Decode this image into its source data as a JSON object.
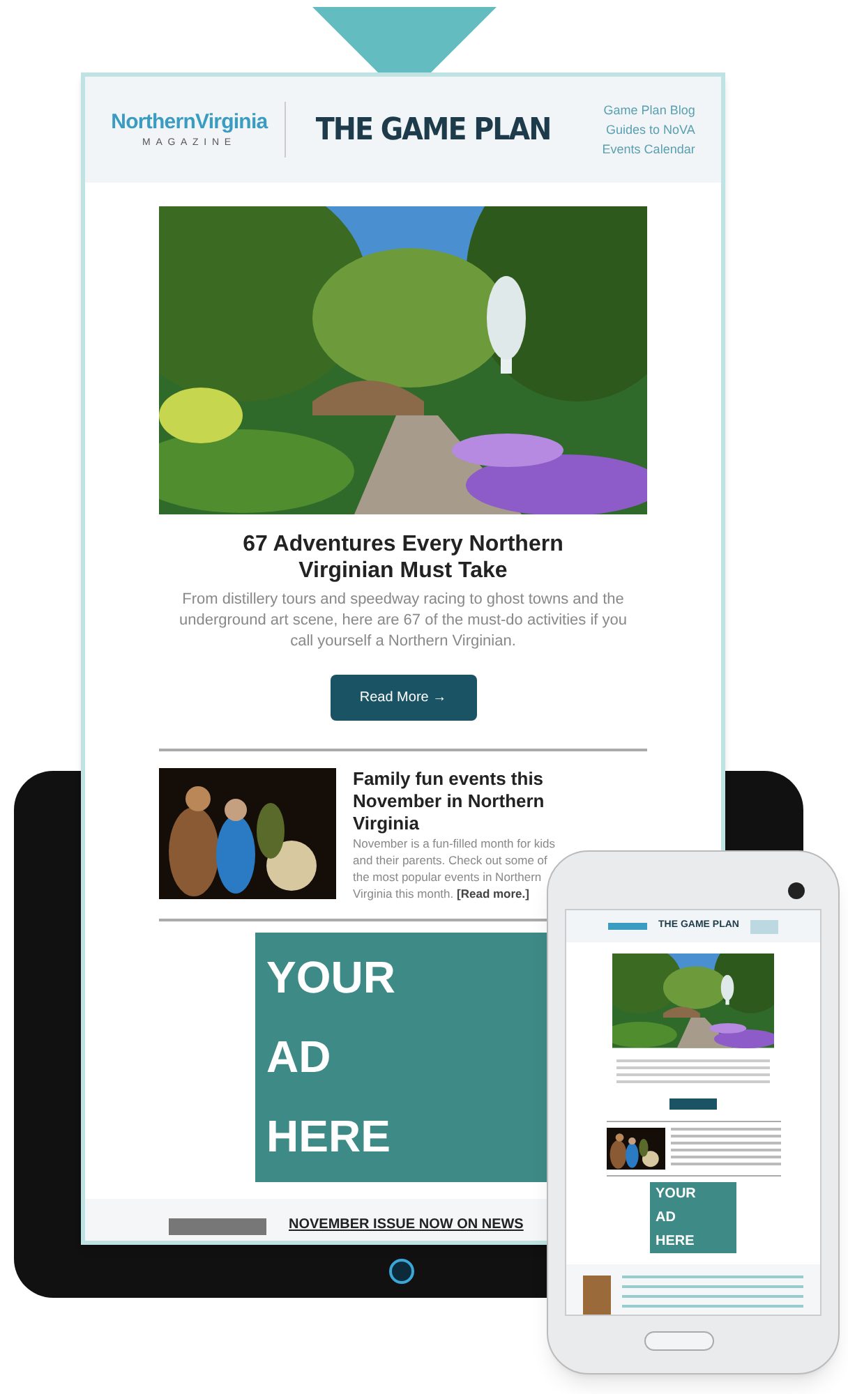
{
  "email": {
    "logo": {
      "name": "NorthernVirginia",
      "sub": "MAGAZINE"
    },
    "title": "THE GAME PLAN",
    "links": [
      "Game Plan Blog",
      "Guides to NoVA",
      "Events Calendar"
    ],
    "feature": {
      "headline": "67 Adventures Every Northern Virginian Must Take",
      "text": "From distillery tours and speedway racing to ghost towns and the underground art scene, here are 67 of the must-do activities if you call yourself a Northern Virginian.",
      "button": "Read More →"
    },
    "article": {
      "title": "Family fun events this November in Northern Virginia",
      "text": "November is a fun-filled month for kids and their parents. Check out some of the most popular events in Northern Virginia this month.",
      "link": "[Read more.]"
    },
    "ad": [
      "YOUR",
      "AD",
      "HERE"
    ],
    "issue": "NOVEMBER ISSUE NOW ON NEWS"
  },
  "phone": {
    "title": "THE GAME PLAN",
    "ad": [
      "YOUR",
      "AD",
      "HERE"
    ]
  }
}
